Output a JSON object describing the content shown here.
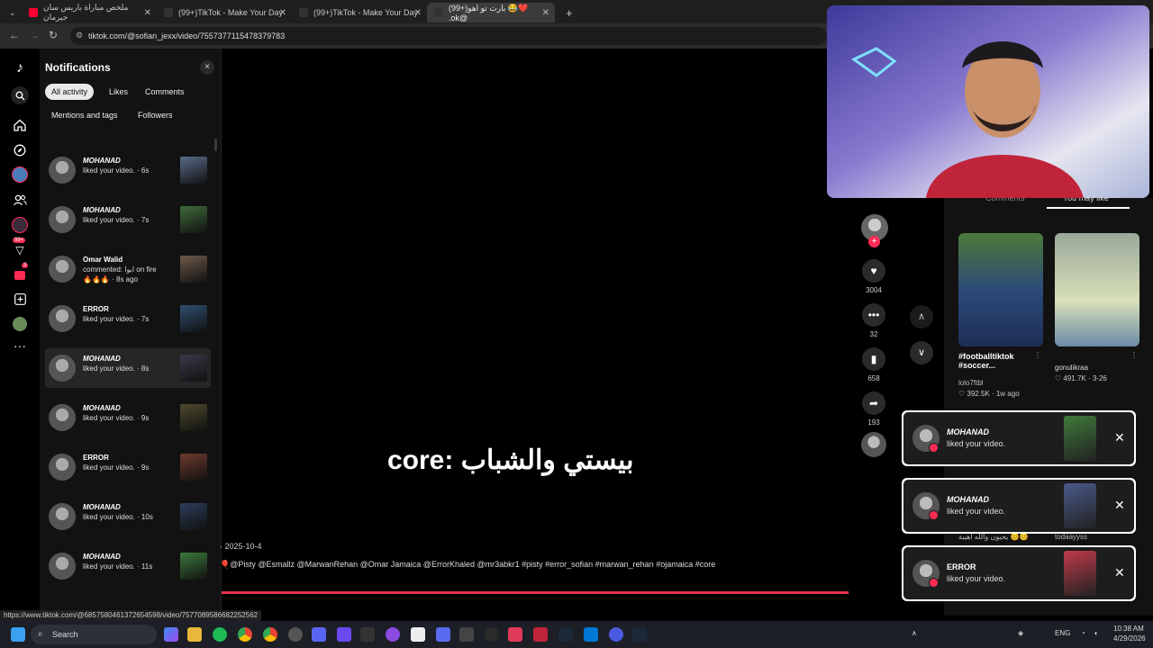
{
  "browser": {
    "tabs": [
      {
        "title": "ملخص مباراة باريس سان جيرمان",
        "color": "#ff0033"
      },
      {
        "title": "(99+)TikTok - Make Your Day",
        "color": "#111111"
      },
      {
        "title": "(99+)TikTok - Make Your Day",
        "color": "#111111"
      },
      {
        "title": "(99+)بارت تو اهو 😂❤️ .ok@",
        "color": "#111111"
      }
    ],
    "new_tab": "+",
    "url": "tiktok.com/@sofian_jexx/video/7557377115478379783",
    "status_url": "https://www.tiktok.com/@6857580461372654598/video/7577089586682252562"
  },
  "rail": {
    "inbox_badge": "99+",
    "messages_badge": "3"
  },
  "notifications": {
    "title": "Notifications",
    "close": "×",
    "filters": [
      "All activity",
      "Likes",
      "Comments",
      "Mentions and tags",
      "Followers"
    ],
    "items": [
      {
        "name": "MOHANAD",
        "text": "liked your video. · 6s",
        "extra": "",
        "italic": true,
        "thumb": "#5a6c8a"
      },
      {
        "name": "MOHANAD",
        "text": "liked your video. · 7s",
        "extra": "",
        "italic": true,
        "thumb": "#3f6b3a"
      },
      {
        "name": "Omar Walid",
        "text": "commented: ابوا on fire",
        "extra": "🔥🔥🔥 · 8s ago",
        "italic": false,
        "thumb": "#6e5a4a"
      },
      {
        "name": "ERROR",
        "text": "liked your video. · 7s",
        "extra": "",
        "italic": false,
        "thumb": "#2f4f6f"
      },
      {
        "name": "MOHANAD",
        "text": "liked your video. · 8s",
        "extra": "",
        "italic": true,
        "thumb": "#3a3a4a"
      },
      {
        "name": "MOHANAD",
        "text": "liked your video. · 9s",
        "extra": "",
        "italic": true,
        "thumb": "#4d4a2c"
      },
      {
        "name": "ERROR",
        "text": "liked your video. · 9s",
        "extra": "",
        "italic": false,
        "thumb": "#6e3a2c"
      },
      {
        "name": "MOHANAD",
        "text": "liked your video. · 10s",
        "extra": "",
        "italic": true,
        "thumb": "#2c3d5a"
      },
      {
        "name": "MOHANAD",
        "text": "liked your video. · 11s",
        "extra": "",
        "italic": true,
        "thumb": "#3c7a3c"
      }
    ]
  },
  "video": {
    "caption": "بيستي والشباب :core",
    "date": "· 2025-10-4",
    "tags": "🎈@Pisty @Esmallz @MarwanRehan @Omar Jamaica @ErrorKhaled @mr3abkr1 #pisty #error_sofian #marwan_rehan #ojamaica #core",
    "likes": "3004",
    "comments": "32",
    "saves": "658",
    "shares": "193"
  },
  "right_panel": {
    "tab_comments": "Comments",
    "tab_you_may_like": "You may like",
    "cards": [
      {
        "title": "#footballtiktok #soccer...",
        "author": "lolo7ftbl",
        "stats": "♡ 392.5K · 1w ago",
        "color": "#2c4a7a"
      },
      {
        "title": "gonulikraa",
        "author": "",
        "stats": "♡ 491.7K · 3-26",
        "color": "#c9cfb8"
      }
    ],
    "partial_labels": [
      "يحبون والله أهيبة 😊😊",
      "todaayyss"
    ]
  },
  "toasts": [
    {
      "name": "MOHANAD",
      "text": "liked your video.",
      "italic": true,
      "thumb": "#3f7a3a"
    },
    {
      "name": "MOHANAD",
      "text": "liked your video.",
      "italic": true,
      "thumb": "#4a5a8a"
    },
    {
      "name": "ERROR",
      "text": "liked your video.",
      "italic": false,
      "thumb": "#c03a4a"
    }
  ],
  "taskbar": {
    "search": "Search",
    "lang": "ENG",
    "time": "10:38 AM",
    "date": "4/29/2026"
  },
  "colors": {
    "accent": "#fe2c55",
    "progress": "#e8304f"
  }
}
